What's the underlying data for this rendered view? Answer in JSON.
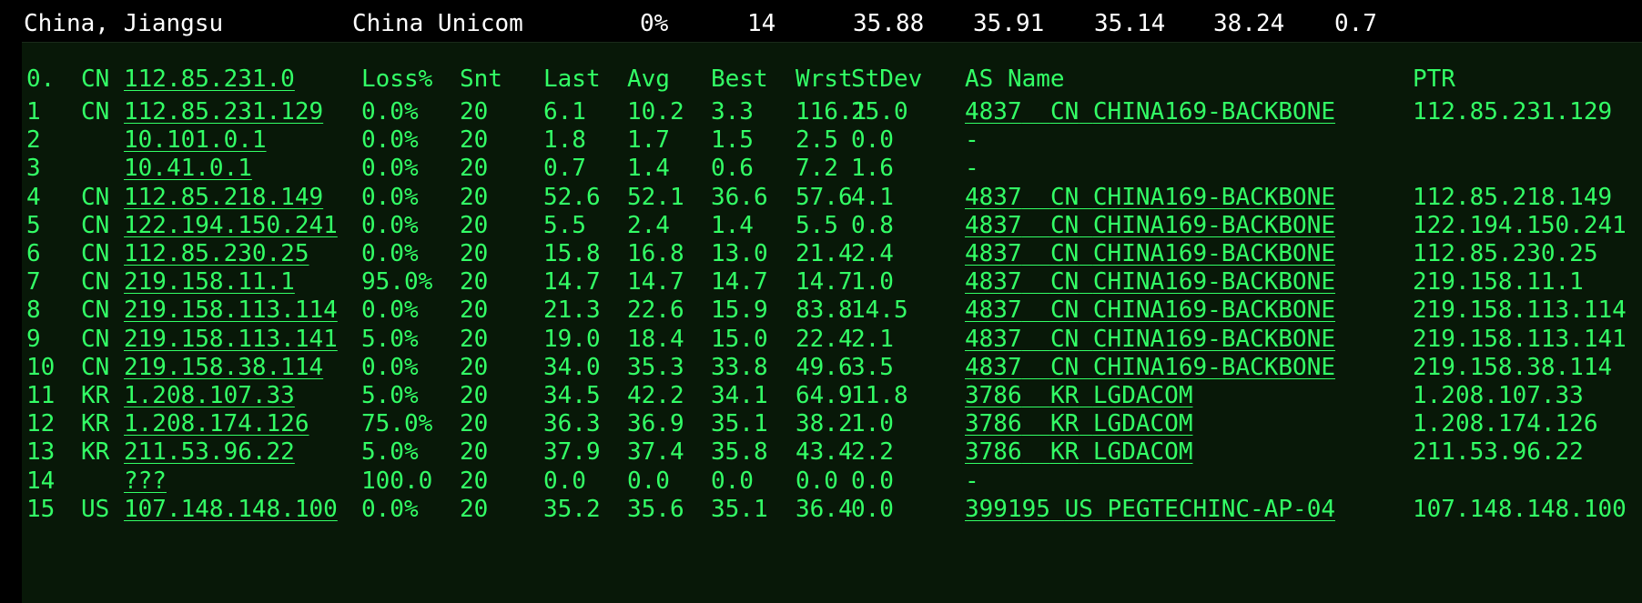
{
  "summary": {
    "region": "China, Jiangsu",
    "isp": "China Unicom",
    "loss": "0%",
    "snt": "14",
    "last": "35.88",
    "avg": "35.91",
    "best": "35.14",
    "wrst": "38.24",
    "stdev": "0.7"
  },
  "header": {
    "hop": "0.",
    "cc": "CN",
    "ip": "112.85.231.0",
    "loss": "Loss%",
    "snt": "Snt",
    "last": "Last",
    "avg": "Avg",
    "best": "Best",
    "wrst": "Wrst",
    "stdev": "StDev",
    "as_name": "AS Name",
    "ptr": "PTR"
  },
  "hops": [
    {
      "hop": "1",
      "cc": "CN",
      "ip": "112.85.231.129",
      "loss": "0.0%",
      "snt": "20",
      "last": "6.1",
      "avg": "10.2",
      "best": "3.3",
      "wrst": "116.1",
      "stdev": "25.0",
      "asn": "4837",
      "as_cc": "CN",
      "as_name": "CHINA169-BACKBONE",
      "ptr": "112.85.231.129"
    },
    {
      "hop": "2",
      "cc": "",
      "ip": "10.101.0.1",
      "loss": "0.0%",
      "snt": "20",
      "last": "1.8",
      "avg": "1.7",
      "best": "1.5",
      "wrst": "2.5",
      "stdev": "0.0",
      "asn": "-",
      "as_cc": "",
      "as_name": "",
      "ptr": ""
    },
    {
      "hop": "3",
      "cc": "",
      "ip": "10.41.0.1",
      "loss": "0.0%",
      "snt": "20",
      "last": "0.7",
      "avg": "1.4",
      "best": "0.6",
      "wrst": "7.2",
      "stdev": "1.6",
      "asn": "-",
      "as_cc": "",
      "as_name": "",
      "ptr": ""
    },
    {
      "hop": "4",
      "cc": "CN",
      "ip": "112.85.218.149",
      "loss": "0.0%",
      "snt": "20",
      "last": "52.6",
      "avg": "52.1",
      "best": "36.6",
      "wrst": "57.6",
      "stdev": "4.1",
      "asn": "4837",
      "as_cc": "CN",
      "as_name": "CHINA169-BACKBONE",
      "ptr": "112.85.218.149"
    },
    {
      "hop": "5",
      "cc": "CN",
      "ip": "122.194.150.241",
      "loss": "0.0%",
      "snt": "20",
      "last": "5.5",
      "avg": "2.4",
      "best": "1.4",
      "wrst": "5.5",
      "stdev": "0.8",
      "asn": "4837",
      "as_cc": "CN",
      "as_name": "CHINA169-BACKBONE",
      "ptr": "122.194.150.241"
    },
    {
      "hop": "6",
      "cc": "CN",
      "ip": "112.85.230.25",
      "loss": "0.0%",
      "snt": "20",
      "last": "15.8",
      "avg": "16.8",
      "best": "13.0",
      "wrst": "21.4",
      "stdev": "2.4",
      "asn": "4837",
      "as_cc": "CN",
      "as_name": "CHINA169-BACKBONE",
      "ptr": "112.85.230.25"
    },
    {
      "hop": "7",
      "cc": "CN",
      "ip": "219.158.11.1",
      "loss": "95.0%",
      "snt": "20",
      "last": "14.7",
      "avg": "14.7",
      "best": "14.7",
      "wrst": "14.7",
      "stdev": "1.0",
      "asn": "4837",
      "as_cc": "CN",
      "as_name": "CHINA169-BACKBONE",
      "ptr": "219.158.11.1"
    },
    {
      "hop": "8",
      "cc": "CN",
      "ip": "219.158.113.114",
      "loss": "0.0%",
      "snt": "20",
      "last": "21.3",
      "avg": "22.6",
      "best": "15.9",
      "wrst": "83.8",
      "stdev": "14.5",
      "asn": "4837",
      "as_cc": "CN",
      "as_name": "CHINA169-BACKBONE",
      "ptr": "219.158.113.114"
    },
    {
      "hop": "9",
      "cc": "CN",
      "ip": "219.158.113.141",
      "loss": "5.0%",
      "snt": "20",
      "last": "19.0",
      "avg": "18.4",
      "best": "15.0",
      "wrst": "22.4",
      "stdev": "2.1",
      "asn": "4837",
      "as_cc": "CN",
      "as_name": "CHINA169-BACKBONE",
      "ptr": "219.158.113.141"
    },
    {
      "hop": "10",
      "cc": "CN",
      "ip": "219.158.38.114",
      "loss": "0.0%",
      "snt": "20",
      "last": "34.0",
      "avg": "35.3",
      "best": "33.8",
      "wrst": "49.6",
      "stdev": "3.5",
      "asn": "4837",
      "as_cc": "CN",
      "as_name": "CHINA169-BACKBONE",
      "ptr": "219.158.38.114"
    },
    {
      "hop": "11",
      "cc": "KR",
      "ip": "1.208.107.33",
      "loss": "5.0%",
      "snt": "20",
      "last": "34.5",
      "avg": "42.2",
      "best": "34.1",
      "wrst": "64.9",
      "stdev": "11.8",
      "asn": "3786",
      "as_cc": "KR",
      "as_name": "LGDACOM",
      "ptr": "1.208.107.33"
    },
    {
      "hop": "12",
      "cc": "KR",
      "ip": "1.208.174.126",
      "loss": "75.0%",
      "snt": "20",
      "last": "36.3",
      "avg": "36.9",
      "best": "35.1",
      "wrst": "38.2",
      "stdev": "1.0",
      "asn": "3786",
      "as_cc": "KR",
      "as_name": "LGDACOM",
      "ptr": "1.208.174.126"
    },
    {
      "hop": "13",
      "cc": "KR",
      "ip": "211.53.96.22",
      "loss": "5.0%",
      "snt": "20",
      "last": "37.9",
      "avg": "37.4",
      "best": "35.8",
      "wrst": "43.4",
      "stdev": "2.2",
      "asn": "3786",
      "as_cc": "KR",
      "as_name": "LGDACOM",
      "ptr": "211.53.96.22"
    },
    {
      "hop": "14",
      "cc": "",
      "ip": "???",
      "loss": "100.0",
      "snt": "20",
      "last": "0.0",
      "avg": "0.0",
      "best": "0.0",
      "wrst": "0.0",
      "stdev": "0.0",
      "asn": "-",
      "as_cc": "",
      "as_name": "",
      "ptr": ""
    },
    {
      "hop": "15",
      "cc": "US",
      "ip": "107.148.148.100",
      "loss": "0.0%",
      "snt": "20",
      "last": "35.2",
      "avg": "35.6",
      "best": "35.1",
      "wrst": "36.4",
      "stdev": "0.0",
      "asn": "399195",
      "as_cc": "US",
      "as_name": "PEGTECHINC-AP-04",
      "ptr": "107.148.148.100"
    }
  ],
  "colors": {
    "terminal_bg": "#081808",
    "text_green": "#33ff66",
    "summary_text": "#ffffff"
  }
}
